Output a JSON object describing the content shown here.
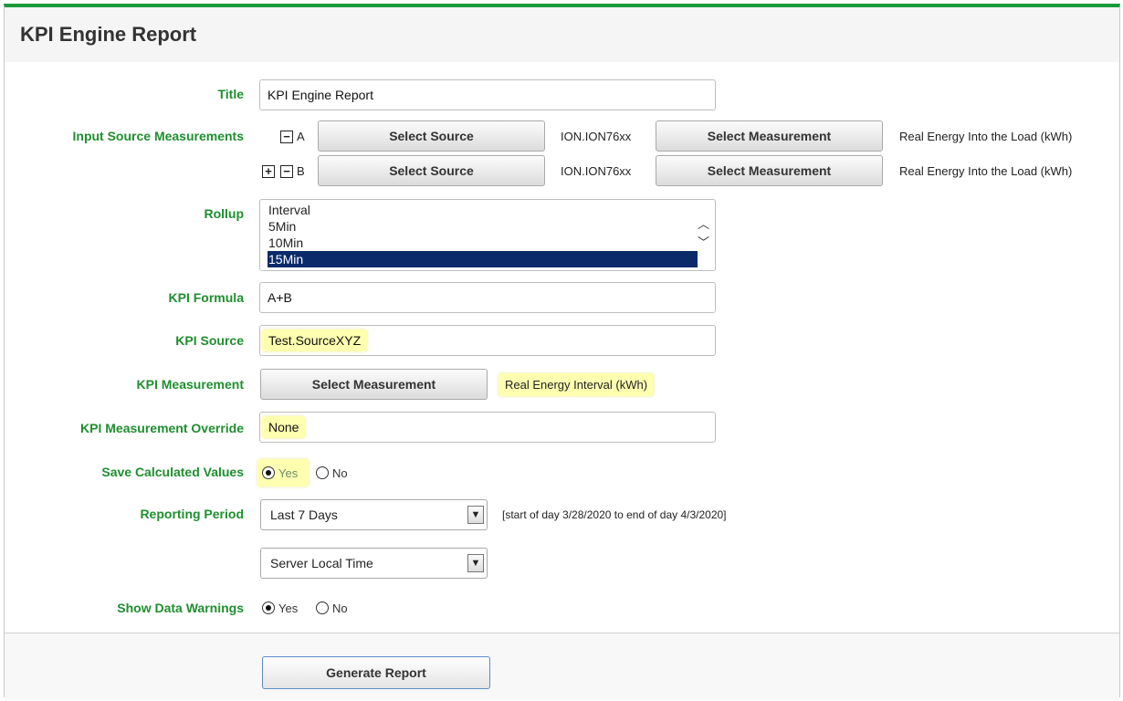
{
  "page": {
    "title": "KPI Engine Report"
  },
  "fields": {
    "title": {
      "label": "Title",
      "value": "KPI Engine Report"
    },
    "input_source": {
      "label": "Input Source Measurements",
      "rows": [
        {
          "letter": "A",
          "source_btn": "Select Source",
          "source_value": "ION.ION76xx",
          "meas_btn": "Select Measurement",
          "meas_value": "Real Energy Into the Load (kWh)"
        },
        {
          "letter": "B",
          "source_btn": "Select Source",
          "source_value": "ION.ION76xx",
          "meas_btn": "Select Measurement",
          "meas_value": "Real Energy Into the Load (kWh)"
        }
      ]
    },
    "rollup": {
      "label": "Rollup",
      "options": [
        "Interval",
        "5Min",
        "10Min",
        "15Min"
      ],
      "selected": "15Min"
    },
    "kpi_formula": {
      "label": "KPI Formula",
      "value": "A+B"
    },
    "kpi_source": {
      "label": "KPI Source",
      "value": "Test.SourceXYZ"
    },
    "kpi_measurement": {
      "label": "KPI Measurement",
      "button": "Select Measurement",
      "value": "Real Energy Interval (kWh)"
    },
    "kpi_override": {
      "label": "KPI Measurement Override",
      "value": "None"
    },
    "save_values": {
      "label": "Save Calculated Values",
      "yes": "Yes",
      "no": "No",
      "selected": "Yes"
    },
    "reporting_period": {
      "label": "Reporting Period",
      "value": "Last 7 Days",
      "range_text": "[start of day 3/28/2020 to end of day 4/3/2020]",
      "timezone": "Server Local Time"
    },
    "data_warnings": {
      "label": "Show Data Warnings",
      "yes": "Yes",
      "no": "No",
      "selected": "Yes"
    }
  },
  "footer": {
    "generate": "Generate Report"
  },
  "colors": {
    "accent_green": "#1a9a3a",
    "label_green": "#1e8f2e",
    "highlight": "#ffffb0",
    "selected_option": "#0a2a6a"
  }
}
